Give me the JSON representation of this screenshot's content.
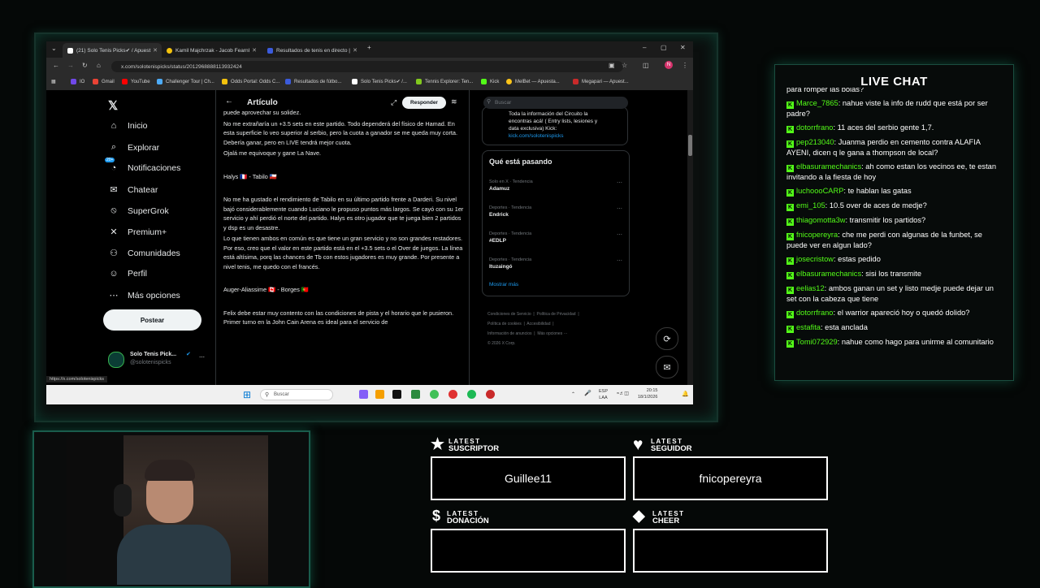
{
  "browser": {
    "tabs": [
      {
        "label": "(21) Solo Tenis Picks✔ / Apuest",
        "active": true
      },
      {
        "label": "Kamil Majchrzak - Jacob Fearnl",
        "active": false
      },
      {
        "label": "Resultados de tenis en directo |",
        "active": false
      }
    ],
    "new_tab": "+",
    "window_controls": {
      "minimize": "–",
      "maximize": "▢",
      "close": "✕"
    },
    "address": "x.com/solotenispicks/status/2012968888113932424",
    "bookmarks": [
      "IO",
      "Gmail",
      "YouTube",
      "Challenger Tour | Ch...",
      "Odds Portal: Odds C...",
      "Resultados de fútbo...",
      "Solo Tenis Picks✔ /...",
      "Tennis Explorer: Ten...",
      "Kick",
      "MelBet — Apuesta...",
      "Megapari — Apuest..."
    ],
    "status_url": "https://x.com/solotenispicks"
  },
  "x": {
    "nav": [
      {
        "label": "Inicio",
        "icon": "home-icon",
        "glyph": "⌂"
      },
      {
        "label": "Explorar",
        "icon": "search-icon",
        "glyph": "⌕"
      },
      {
        "label": "Notificaciones",
        "icon": "bell-icon",
        "glyph": "◔",
        "badge": "20+"
      },
      {
        "label": "Chatear",
        "icon": "mail-icon",
        "glyph": "✉"
      },
      {
        "label": "SuperGrok",
        "icon": "grok-icon",
        "glyph": "⦸"
      },
      {
        "label": "Premium+",
        "icon": "x-icon",
        "glyph": "✕"
      },
      {
        "label": "Comunidades",
        "icon": "people-icon",
        "glyph": "⚇"
      },
      {
        "label": "Perfil",
        "icon": "person-icon",
        "glyph": "☺"
      },
      {
        "label": "Más opciones",
        "icon": "more-icon",
        "glyph": "⋯"
      }
    ],
    "post_button": "Postear",
    "account": {
      "name": "Solo Tenis Pick...",
      "handle": "@solotenispicks"
    },
    "article": {
      "title": "Artículo",
      "reply_button": "Responder",
      "paragraphs": [
        "puede aprovechar su solidez.",
        "No me extrañaría un +3.5 sets en este partido. Todo dependerá del físico de Hamad. En esta superficie lo veo superior al serbio, pero la cuota a ganador se me queda muy corta. Debería ganar, pero en LIVE tendrá mejor cuota.",
        "Ojalá me equivoque y gane La Nave.",
        "Halys 🇫🇷 - Tabilo 🇨🇱",
        "No me ha gustado el rendimiento de Tabilo en su último partido frente a Darderi. Su nivel bajó considerablemente cuando Luciano le propuso puntos más largos. Se cayó con su 1er servicio y ahí perdió el norte del partido. Halys es otro jugador que te juega bien 2 partidos y dsp es un desastre.",
        "Lo que tienen ambos en común es que tiene un gran servicio y no son grandes restadores. Por eso, creo que el valor en este partido está en el +3.5 sets o el Over de juegos. La línea está altísima, porq las chances de Tb con estos jugadores es muy grande. Por presente a nivel tenis, me quedo con el francés.",
        "Auger-Aliassime 🇨🇦 - Borges 🇵🇹",
        "Felix debe estar muy contento con las condiciones de pista y el horario que le pusieron. Primer turno en la John Cain Arena es ideal para el servicio de"
      ]
    },
    "search_placeholder": "Buscar",
    "promo": {
      "lines": [
        "Toda la información del Circuito la",
        "encontras acá! ( Entry lists, lesiones y",
        "data exclusiva) Kick:"
      ],
      "link": "kick.com/solotenispicks"
    },
    "trending": {
      "title": "Qué está pasando",
      "items": [
        {
          "category": "Solo en X · Tendencia",
          "name": "Adamuz"
        },
        {
          "category": "Deportes · Tendencia",
          "name": "Endrick"
        },
        {
          "category": "Deportes · Tendencia",
          "name": "#EDLP"
        },
        {
          "category": "Deportes · Tendencia",
          "name": "Ituzaingó"
        }
      ],
      "more": "Mostrar más"
    },
    "footer": [
      "Condiciones de Servicio",
      "Política de Privacidad",
      "Política de cookies",
      "Accesibilidad",
      "Información de anuncios",
      "Más opciones ···",
      "© 2026 X Corp."
    ]
  },
  "taskbar": {
    "search": "Buscar",
    "lang": "ESP",
    "lang2": "LAA",
    "time": "20:15",
    "date": "18/1/2026"
  },
  "chat": {
    "title": "LIVE CHAT",
    "first_line": "para romper las bolas?",
    "messages": [
      {
        "user": "Marce_7865",
        "text": "nahue viste la info de rudd que está por ser padre?"
      },
      {
        "user": "dotorrfrano",
        "text": "11 aces del serbio gente 1,7."
      },
      {
        "user": "pep213040",
        "text": "Juanma perdio en cemento contra ALAFIA AYENI, dicen q le gana a thompson de local?"
      },
      {
        "user": "elbasuramechanics",
        "text": "ah como estan los vecinos ee, te estan invitando a la fiesta de hoy"
      },
      {
        "user": "luchoooCARP",
        "text": "te hablan las gatas"
      },
      {
        "user": "emi_105",
        "text": "10.5 over de aces de medje?"
      },
      {
        "user": "thiagomotta3w",
        "text": "transmitir los partidos?"
      },
      {
        "user": "fnicopereyra",
        "text": "che me perdi con algunas de la funbet, se puede ver en algun lado?"
      },
      {
        "user": "josecristow",
        "text": "estas pedido"
      },
      {
        "user": "elbasuramechanics",
        "text": "sisi los transmite"
      },
      {
        "user": "eelias12",
        "text": "ambos ganan un set y listo medje puede dejar un set con la cabeza que tiene"
      },
      {
        "user": "dotorrfrano",
        "text": "el warrior apareció hoy o quedó dolido?"
      },
      {
        "user": "estafita",
        "text": "esta anclada"
      },
      {
        "user": "Tomi072929",
        "text": "nahue como hago para unirme al comunitario"
      }
    ]
  },
  "alerts": [
    {
      "kicker": "LATEST",
      "label": "SUSCRIPTOR",
      "value": "Guillee11",
      "icon": "star-icon",
      "glyph": "★"
    },
    {
      "kicker": "LATEST",
      "label": "SEGUIDOR",
      "value": "fnicopereyra",
      "icon": "heart-icon",
      "glyph": "♥"
    },
    {
      "kicker": "LATEST",
      "label": "DONACIÓN",
      "value": "",
      "icon": "dollar-icon",
      "glyph": "$"
    },
    {
      "kicker": "LATEST",
      "label": "CHEER",
      "value": "",
      "icon": "diamond-icon",
      "glyph": "◆"
    }
  ]
}
